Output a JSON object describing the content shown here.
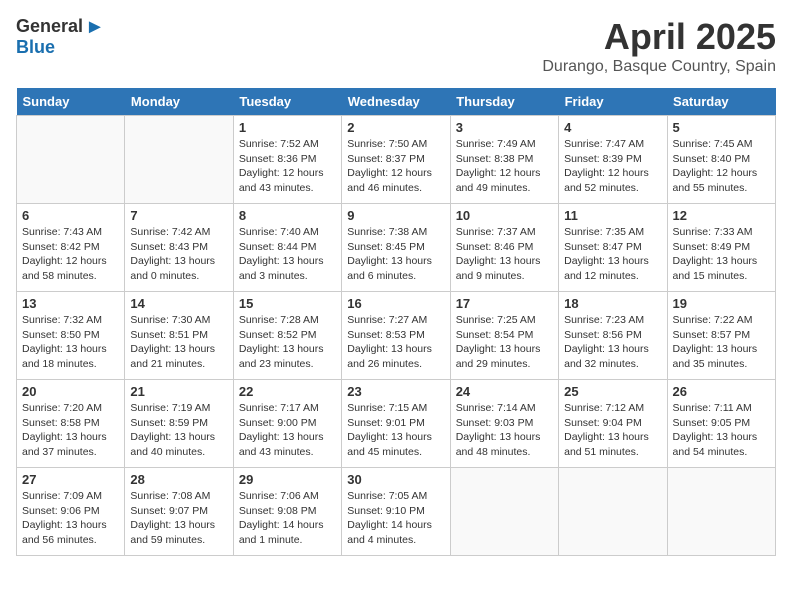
{
  "header": {
    "logo_general": "General",
    "logo_blue": "Blue",
    "month_title": "April 2025",
    "location": "Durango, Basque Country, Spain"
  },
  "weekdays": [
    "Sunday",
    "Monday",
    "Tuesday",
    "Wednesday",
    "Thursday",
    "Friday",
    "Saturday"
  ],
  "weeks": [
    [
      {
        "day": "",
        "info": ""
      },
      {
        "day": "",
        "info": ""
      },
      {
        "day": "1",
        "info": "Sunrise: 7:52 AM\nSunset: 8:36 PM\nDaylight: 12 hours and 43 minutes."
      },
      {
        "day": "2",
        "info": "Sunrise: 7:50 AM\nSunset: 8:37 PM\nDaylight: 12 hours and 46 minutes."
      },
      {
        "day": "3",
        "info": "Sunrise: 7:49 AM\nSunset: 8:38 PM\nDaylight: 12 hours and 49 minutes."
      },
      {
        "day": "4",
        "info": "Sunrise: 7:47 AM\nSunset: 8:39 PM\nDaylight: 12 hours and 52 minutes."
      },
      {
        "day": "5",
        "info": "Sunrise: 7:45 AM\nSunset: 8:40 PM\nDaylight: 12 hours and 55 minutes."
      }
    ],
    [
      {
        "day": "6",
        "info": "Sunrise: 7:43 AM\nSunset: 8:42 PM\nDaylight: 12 hours and 58 minutes."
      },
      {
        "day": "7",
        "info": "Sunrise: 7:42 AM\nSunset: 8:43 PM\nDaylight: 13 hours and 0 minutes."
      },
      {
        "day": "8",
        "info": "Sunrise: 7:40 AM\nSunset: 8:44 PM\nDaylight: 13 hours and 3 minutes."
      },
      {
        "day": "9",
        "info": "Sunrise: 7:38 AM\nSunset: 8:45 PM\nDaylight: 13 hours and 6 minutes."
      },
      {
        "day": "10",
        "info": "Sunrise: 7:37 AM\nSunset: 8:46 PM\nDaylight: 13 hours and 9 minutes."
      },
      {
        "day": "11",
        "info": "Sunrise: 7:35 AM\nSunset: 8:47 PM\nDaylight: 13 hours and 12 minutes."
      },
      {
        "day": "12",
        "info": "Sunrise: 7:33 AM\nSunset: 8:49 PM\nDaylight: 13 hours and 15 minutes."
      }
    ],
    [
      {
        "day": "13",
        "info": "Sunrise: 7:32 AM\nSunset: 8:50 PM\nDaylight: 13 hours and 18 minutes."
      },
      {
        "day": "14",
        "info": "Sunrise: 7:30 AM\nSunset: 8:51 PM\nDaylight: 13 hours and 21 minutes."
      },
      {
        "day": "15",
        "info": "Sunrise: 7:28 AM\nSunset: 8:52 PM\nDaylight: 13 hours and 23 minutes."
      },
      {
        "day": "16",
        "info": "Sunrise: 7:27 AM\nSunset: 8:53 PM\nDaylight: 13 hours and 26 minutes."
      },
      {
        "day": "17",
        "info": "Sunrise: 7:25 AM\nSunset: 8:54 PM\nDaylight: 13 hours and 29 minutes."
      },
      {
        "day": "18",
        "info": "Sunrise: 7:23 AM\nSunset: 8:56 PM\nDaylight: 13 hours and 32 minutes."
      },
      {
        "day": "19",
        "info": "Sunrise: 7:22 AM\nSunset: 8:57 PM\nDaylight: 13 hours and 35 minutes."
      }
    ],
    [
      {
        "day": "20",
        "info": "Sunrise: 7:20 AM\nSunset: 8:58 PM\nDaylight: 13 hours and 37 minutes."
      },
      {
        "day": "21",
        "info": "Sunrise: 7:19 AM\nSunset: 8:59 PM\nDaylight: 13 hours and 40 minutes."
      },
      {
        "day": "22",
        "info": "Sunrise: 7:17 AM\nSunset: 9:00 PM\nDaylight: 13 hours and 43 minutes."
      },
      {
        "day": "23",
        "info": "Sunrise: 7:15 AM\nSunset: 9:01 PM\nDaylight: 13 hours and 45 minutes."
      },
      {
        "day": "24",
        "info": "Sunrise: 7:14 AM\nSunset: 9:03 PM\nDaylight: 13 hours and 48 minutes."
      },
      {
        "day": "25",
        "info": "Sunrise: 7:12 AM\nSunset: 9:04 PM\nDaylight: 13 hours and 51 minutes."
      },
      {
        "day": "26",
        "info": "Sunrise: 7:11 AM\nSunset: 9:05 PM\nDaylight: 13 hours and 54 minutes."
      }
    ],
    [
      {
        "day": "27",
        "info": "Sunrise: 7:09 AM\nSunset: 9:06 PM\nDaylight: 13 hours and 56 minutes."
      },
      {
        "day": "28",
        "info": "Sunrise: 7:08 AM\nSunset: 9:07 PM\nDaylight: 13 hours and 59 minutes."
      },
      {
        "day": "29",
        "info": "Sunrise: 7:06 AM\nSunset: 9:08 PM\nDaylight: 14 hours and 1 minute."
      },
      {
        "day": "30",
        "info": "Sunrise: 7:05 AM\nSunset: 9:10 PM\nDaylight: 14 hours and 4 minutes."
      },
      {
        "day": "",
        "info": ""
      },
      {
        "day": "",
        "info": ""
      },
      {
        "day": "",
        "info": ""
      }
    ]
  ]
}
